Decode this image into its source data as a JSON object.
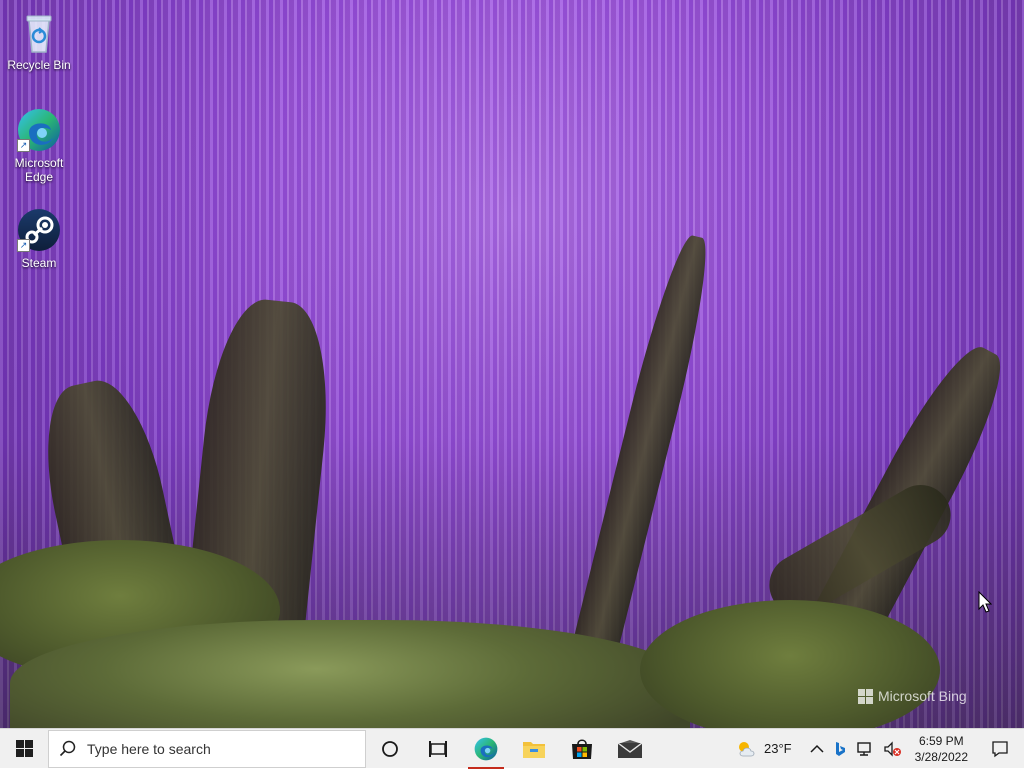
{
  "desktop": {
    "icons": [
      {
        "label": "Recycle Bin",
        "icon": "recycle-bin-icon"
      },
      {
        "label": "Microsoft Edge",
        "icon": "edge-icon"
      },
      {
        "label": "Steam",
        "icon": "steam-icon"
      }
    ],
    "watermark": "Microsoft Bing"
  },
  "taskbar": {
    "search_placeholder": "Type here to search",
    "pinned": [
      {
        "name": "cortana",
        "icon": "circle-icon"
      },
      {
        "name": "task-view",
        "icon": "task-view-icon"
      },
      {
        "name": "edge",
        "icon": "edge-icon",
        "active": true
      },
      {
        "name": "file-explorer",
        "icon": "folder-icon"
      },
      {
        "name": "microsoft-store",
        "icon": "store-icon"
      },
      {
        "name": "mail",
        "icon": "mail-icon"
      }
    ],
    "weather": {
      "temp": "23°F",
      "icon": "partly-cloudy-icon"
    },
    "clock": {
      "time": "6:59 PM",
      "date": "3/28/2022"
    }
  },
  "colors": {
    "taskbar_bg": "#f0f0f0",
    "edge_active": "#c42b1c",
    "accent": "#0078d4"
  }
}
